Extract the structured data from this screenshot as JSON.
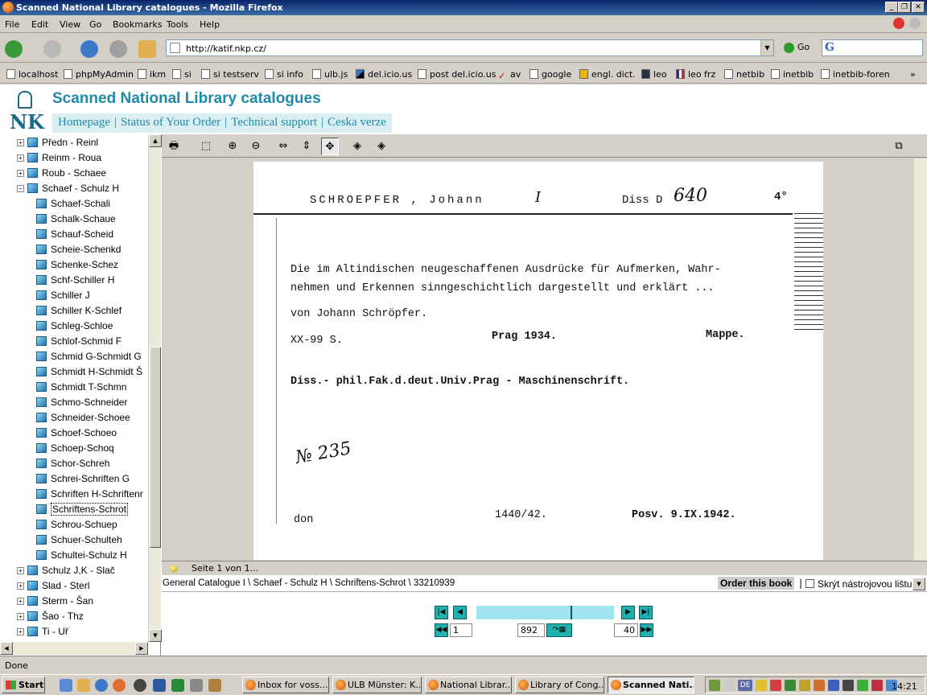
{
  "window": {
    "title": "Scanned National Library catalogues - Mozilla Firefox"
  },
  "menu": [
    "File",
    "Edit",
    "View",
    "Go",
    "Bookmarks",
    "Tools",
    "Help"
  ],
  "nav": {
    "url": "http://katif.nkp.cz/",
    "go_label": "Go",
    "search_logo": "G"
  },
  "bookmarks": [
    "localhost",
    "phpMyAdmin",
    "ikm",
    "si",
    "si testserv",
    "si info",
    "ulb.js",
    "del.icio.us",
    "post del.icio.us",
    "av",
    "google",
    "engl. dict.",
    "leo",
    "leo frz",
    "netbib",
    "inetbib",
    "inetbib-foren"
  ],
  "bookmarks_more": "»",
  "site": {
    "logo": "NK",
    "title": "Scanned National Library catalogues",
    "nav": [
      "Homepage",
      "Status of Your Order",
      "Technical support",
      "Ceska verze"
    ]
  },
  "tree": {
    "top_nodes": [
      "Předn - Reinl",
      "Reinm - Roua",
      "Roub - Schaee"
    ],
    "expanded": "Schaef - Schulz H",
    "children": [
      "Schaef-Schali",
      "Schalk-Schaue",
      "Schauf-Scheid",
      "Scheie-Schenkd",
      "Schenke-Schez",
      "Schf-Schiller H",
      "Schiller J",
      "Schiller K-Schlef",
      "Schleg-Schloe",
      "Schlof-Schmid F",
      "Schmid G-Schmidt G",
      "Schmidt H-Schmidt Š",
      "Schmidt T-Schmn",
      "Schmo-Schneider",
      "Schneider-Schoee",
      "Schoef-Schoeo",
      "Schoep-Schoq",
      "Schor-Schreh",
      "Schrei-Schriften G",
      "Schriften H-Schriftenr",
      "Schriftens-Schrot",
      "Schrou-Schuep",
      "Schuer-Schulteh",
      "Schultei-Schulz H"
    ],
    "selected": "Schriftens-Schrot",
    "bottom_nodes": [
      "Schulz J,K - Slač",
      "Slad - Sterl",
      "Sterm - Šan",
      "Šao - Thz",
      "Ti - Uř"
    ]
  },
  "card": {
    "name": "SCHROEPFER , Johann",
    "mark": "I",
    "shelf": "Diss D",
    "shelf_num": "640",
    "format": "4°",
    "line1": "Die im Altindischen neugeschaffenen Ausdrücke für Aufmerken,  Wahr-",
    "line2": "nehmen und Erkennen sinngeschichtlich dargestellt und erklärt ...",
    "line3": "von Johann Schröpfer.",
    "pages": "XX-99 S.",
    "place": "Prag  1934.",
    "binding": "Mappe.",
    "note": "Diss.- phil.Fak.d.deut.Univ.Prag - Maschinenschrift.",
    "number": "№ 235",
    "don": "don",
    "acc": "1440/42.",
    "date": "Posv. 9.IX.1942."
  },
  "viewer": {
    "page_status": "Seite 1 von 1..."
  },
  "pathbar": {
    "path": "General Catalogue I \\ Schaef - Schulz H \\ Schriftens-Schrot \\ 33210939",
    "order": "Order this book",
    "sep": "|",
    "hide_toolbar": "Skrýt nástrojovou lištu"
  },
  "pager": {
    "page": "1",
    "total": "892",
    "step": "40"
  },
  "status": {
    "text": "Done"
  },
  "taskbar": {
    "start": "Start",
    "tasks": [
      "Inbox for voss...",
      "ULB Münster: K...",
      "National Librar...",
      "Library of Cong...",
      "Scanned Nati..."
    ],
    "lang": "DE",
    "time": "14:21"
  }
}
